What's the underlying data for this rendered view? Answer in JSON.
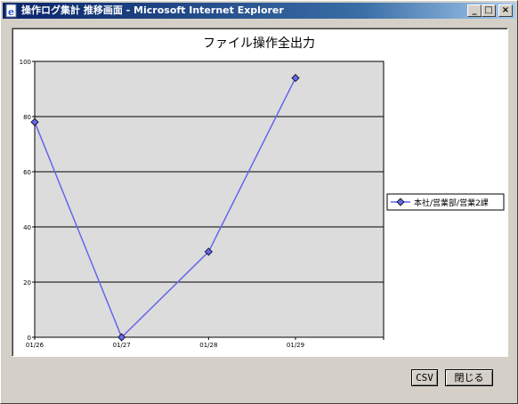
{
  "window": {
    "title": "操作ログ集計 推移画面 - Microsoft Internet Explorer",
    "buttons": {
      "minimize": "_",
      "maximize": "□",
      "close": "×"
    }
  },
  "footer": {
    "csv_label": "CSV",
    "close_label": "閉じる"
  },
  "chart_data": {
    "type": "line",
    "title": "ファイル操作全出力",
    "categories": [
      "01/26",
      "01/27",
      "01/28",
      "01/29"
    ],
    "series": [
      {
        "name": "本社/営業部/営業2課",
        "values": [
          78,
          0,
          31,
          94
        ],
        "color": "#6666ee"
      }
    ],
    "yticks": [
      0,
      20,
      40,
      60,
      80,
      100
    ],
    "ylim": [
      0,
      100
    ],
    "xlabel": "",
    "ylabel": "",
    "grid": true,
    "legend": "right",
    "plot_background": "#dcdcdc"
  }
}
